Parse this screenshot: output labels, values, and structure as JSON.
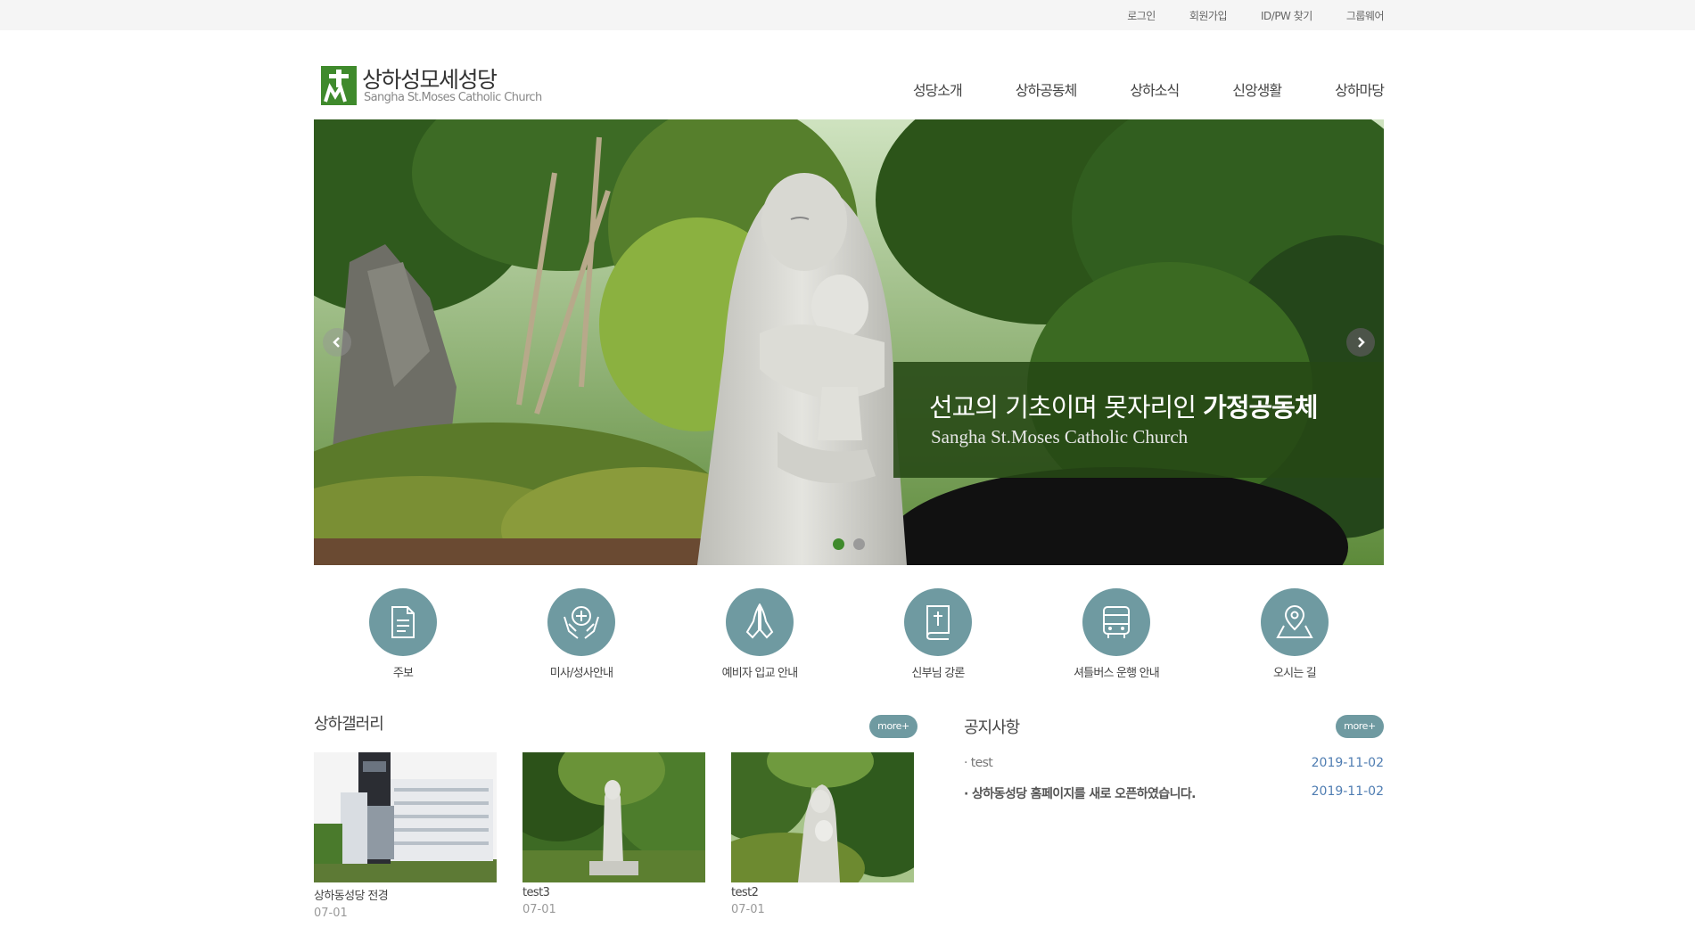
{
  "topbar": {
    "links": [
      "로그인",
      "회원가입",
      "ID/PW 찾기",
      "그룹웨어"
    ]
  },
  "header": {
    "logo_name": "상하성모세성당",
    "logo_sub": "Sangha St.Moses Catholic Church",
    "nav": [
      "성당소개",
      "상하공동체",
      "상하소식",
      "신앙생활",
      "상하마당"
    ]
  },
  "hero": {
    "caption_main": "선교의 기초이며 못자리인 ",
    "caption_bold": "가정공동체",
    "caption_sub": "Sangha St.Moses Catholic Church",
    "slide_count": 2,
    "active_slide": 1
  },
  "quick_links": [
    {
      "label": "주보",
      "icon": "document-icon"
    },
    {
      "label": "미사/성사안내",
      "icon": "hands-cross-icon"
    },
    {
      "label": "예비자 입교 안내",
      "icon": "praying-hands-icon"
    },
    {
      "label": "신부님 강론",
      "icon": "bible-icon"
    },
    {
      "label": "셔틀버스 운행 안내",
      "icon": "bus-icon"
    },
    {
      "label": "오시는 길",
      "icon": "map-pin-icon"
    }
  ],
  "gallery": {
    "title": "상하갤러리",
    "more": "more+",
    "items": [
      {
        "title": "상하동성당 전경",
        "date": "07-01"
      },
      {
        "title": "test3",
        "date": "07-01"
      },
      {
        "title": "test2",
        "date": "07-01"
      }
    ]
  },
  "notice": {
    "title": "공지사항",
    "more": "more+",
    "items": [
      {
        "text": "· test",
        "date": "2019-11-02"
      },
      {
        "text": "· 상하동성당 홈페이지를 새로 오픈하였습니다.",
        "date": "2019-11-02"
      }
    ]
  },
  "colors": {
    "accent_teal": "#6f9aa1",
    "caption_green": "#264814",
    "logo_green": "#3f8a2c",
    "date_blue": "#4f7db2"
  }
}
